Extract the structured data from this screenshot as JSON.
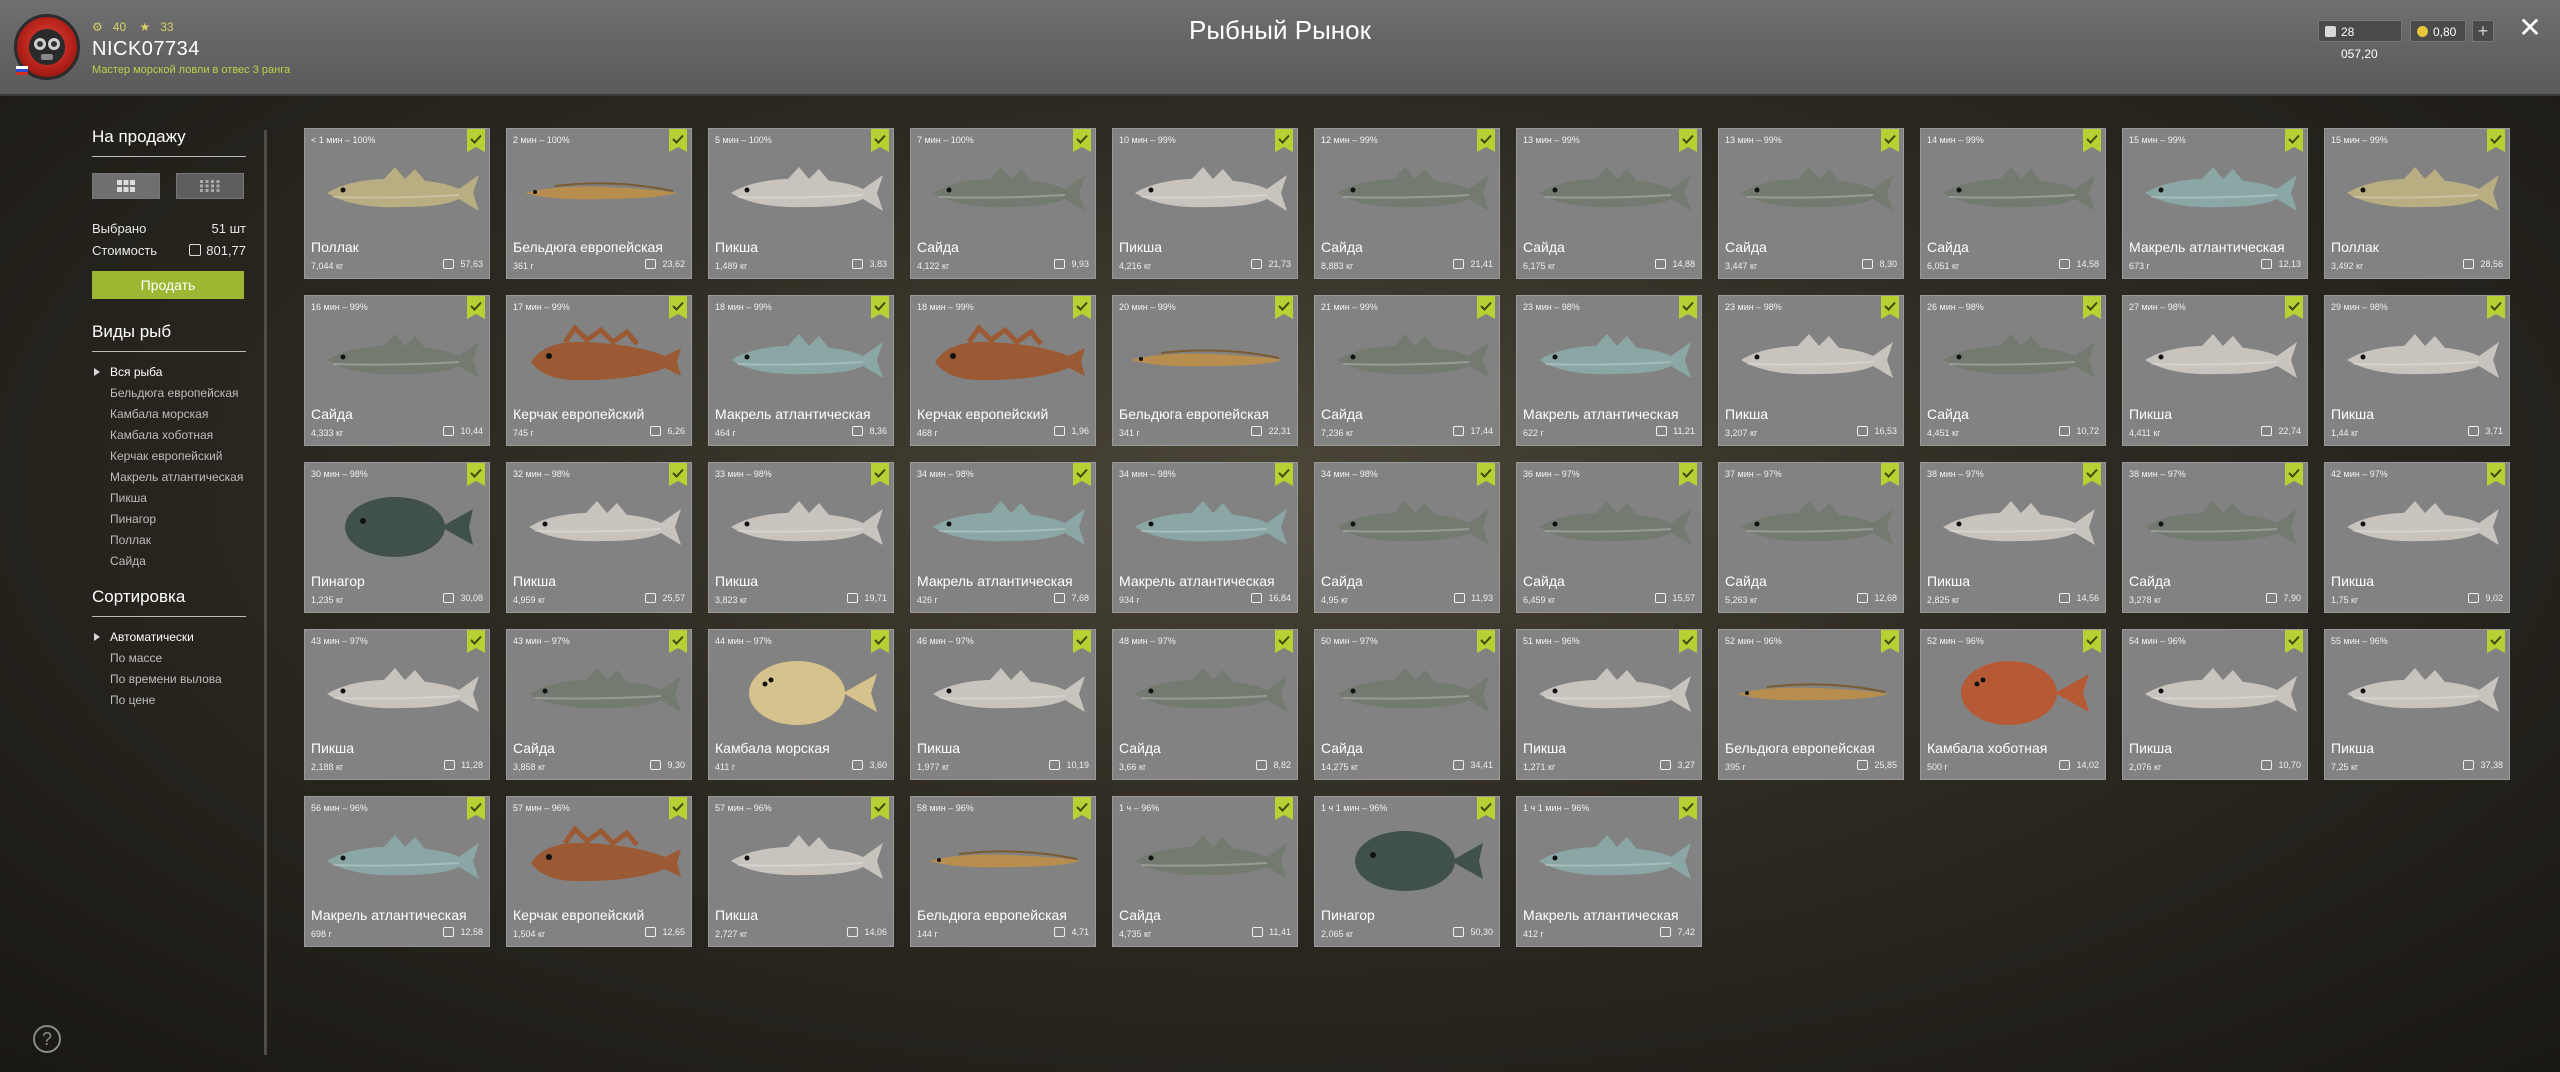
{
  "header": {
    "title": "Рыбный Рынок",
    "player_name": "NICK07734",
    "player_title": "Мастер морской ловли в отвес 3 ранга",
    "level": "40",
    "rank": "33",
    "credits": "28 057,20",
    "gold": "0,80"
  },
  "sidebar": {
    "sale_title": "На продажу",
    "selected_label": "Выбрано",
    "selected_value": "51 шт",
    "cost_label": "Стоимость",
    "cost_value": "801,77",
    "sell_button": "Продать",
    "species_title": "Виды рыб",
    "species": [
      "Вся рыба",
      "Бельдюга европейская",
      "Камбала морская",
      "Камбала хоботная",
      "Керчак европейский",
      "Макрель атлантическая",
      "Пикша",
      "Пинагор",
      "Поллак",
      "Сайда"
    ],
    "sort_title": "Сортировка",
    "sort": [
      "Автоматически",
      "По массе",
      "По времени вылова",
      "По цене"
    ]
  },
  "fish_colors": {
    "Поллак": "#b9ad82",
    "Бельдюга европейская": "#b88e4e",
    "Пикша": "#c9c3bd",
    "Сайда": "#737a70",
    "Макрель атлантическая": "#8aa7a5",
    "Керчак европейский": "#9b5a34",
    "Пинагор": "#3f514a",
    "Камбала морская": "#d6c28d",
    "Камбала хоботная": "#b65a35"
  },
  "cards": [
    {
      "time": "< 1 мин – 100%",
      "name": "Поллак",
      "weight": "7,044 кг",
      "price": "57,63"
    },
    {
      "time": "2 мин – 100%",
      "name": "Бельдюга европейская",
      "weight": "361 г",
      "price": "23,62"
    },
    {
      "time": "5 мин – 100%",
      "name": "Пикша",
      "weight": "1,489 кг",
      "price": "3,83"
    },
    {
      "time": "7 мин – 100%",
      "name": "Сайда",
      "weight": "4,122 кг",
      "price": "9,93"
    },
    {
      "time": "10 мин – 99%",
      "name": "Пикша",
      "weight": "4,216 кг",
      "price": "21,73"
    },
    {
      "time": "12 мин – 99%",
      "name": "Сайда",
      "weight": "8,883 кг",
      "price": "21,41"
    },
    {
      "time": "13 мин – 99%",
      "name": "Сайда",
      "weight": "6,175 кг",
      "price": "14,88"
    },
    {
      "time": "13 мин – 99%",
      "name": "Сайда",
      "weight": "3,447 кг",
      "price": "8,30"
    },
    {
      "time": "14 мин – 99%",
      "name": "Сайда",
      "weight": "6,051 кг",
      "price": "14,58"
    },
    {
      "time": "15 мин – 99%",
      "name": "Макрель атлантическая",
      "weight": "673 г",
      "price": "12,13"
    },
    {
      "time": "15 мин – 99%",
      "name": "Поллак",
      "weight": "3,492 кг",
      "price": "28,56"
    },
    {
      "time": "16 мин – 99%",
      "name": "Сайда",
      "weight": "4,333 кг",
      "price": "10,44"
    },
    {
      "time": "17 мин – 99%",
      "name": "Керчак европейский",
      "weight": "745 г",
      "price": "6,26"
    },
    {
      "time": "18 мин – 99%",
      "name": "Макрель атлантическая",
      "weight": "464 г",
      "price": "8,36"
    },
    {
      "time": "18 мин – 99%",
      "name": "Керчак европейский",
      "weight": "468 г",
      "price": "1,96"
    },
    {
      "time": "20 мин – 99%",
      "name": "Бельдюга европейская",
      "weight": "341 г",
      "price": "22,31"
    },
    {
      "time": "21 мин – 99%",
      "name": "Сайда",
      "weight": "7,236 кг",
      "price": "17,44"
    },
    {
      "time": "23 мин – 98%",
      "name": "Макрель атлантическая",
      "weight": "622 г",
      "price": "11,21"
    },
    {
      "time": "23 мин – 98%",
      "name": "Пикша",
      "weight": "3,207 кг",
      "price": "16,53"
    },
    {
      "time": "26 мин – 98%",
      "name": "Сайда",
      "weight": "4,451 кг",
      "price": "10,72"
    },
    {
      "time": "27 мин – 98%",
      "name": "Пикша",
      "weight": "4,411 кг",
      "price": "22,74"
    },
    {
      "time": "29 мин – 98%",
      "name": "Пикша",
      "weight": "1,44 кг",
      "price": "3,71"
    },
    {
      "time": "30 мин – 98%",
      "name": "Пинагор",
      "weight": "1,235 кг",
      "price": "30,08"
    },
    {
      "time": "32 мин – 98%",
      "name": "Пикша",
      "weight": "4,959 кг",
      "price": "25,57"
    },
    {
      "time": "33 мин – 98%",
      "name": "Пикша",
      "weight": "3,823 кг",
      "price": "19,71"
    },
    {
      "time": "34 мин – 98%",
      "name": "Макрель атлантическая",
      "weight": "426 г",
      "price": "7,68"
    },
    {
      "time": "34 мин – 98%",
      "name": "Макрель атлантическая",
      "weight": "934 г",
      "price": "16,84"
    },
    {
      "time": "34 мин – 98%",
      "name": "Сайда",
      "weight": "4,95 кг",
      "price": "11,93"
    },
    {
      "time": "36 мин – 97%",
      "name": "Сайда",
      "weight": "6,459 кг",
      "price": "15,57"
    },
    {
      "time": "37 мин – 97%",
      "name": "Сайда",
      "weight": "5,263 кг",
      "price": "12,68"
    },
    {
      "time": "38 мин – 97%",
      "name": "Пикша",
      "weight": "2,825 кг",
      "price": "14,56"
    },
    {
      "time": "38 мин – 97%",
      "name": "Сайда",
      "weight": "3,278 кг",
      "price": "7,90"
    },
    {
      "time": "42 мин – 97%",
      "name": "Пикша",
      "weight": "1,75 кг",
      "price": "9,02"
    },
    {
      "time": "43 мин – 97%",
      "name": "Пикша",
      "weight": "2,188 кг",
      "price": "11,28"
    },
    {
      "time": "43 мин – 97%",
      "name": "Сайда",
      "weight": "3,858 кг",
      "price": "9,30"
    },
    {
      "time": "44 мин – 97%",
      "name": "Камбала морская",
      "weight": "411 г",
      "price": "3,60"
    },
    {
      "time": "46 мин – 97%",
      "name": "Пикша",
      "weight": "1,977 кг",
      "price": "10,19"
    },
    {
      "time": "48 мин – 97%",
      "name": "Сайда",
      "weight": "3,66 кг",
      "price": "8,82"
    },
    {
      "time": "50 мин – 97%",
      "name": "Сайда",
      "weight": "14,275 кг",
      "price": "34,41"
    },
    {
      "time": "51 мин – 96%",
      "name": "Пикша",
      "weight": "1,271 кг",
      "price": "3,27"
    },
    {
      "time": "52 мин – 96%",
      "name": "Бельдюга европейская",
      "weight": "395 г",
      "price": "25,85"
    },
    {
      "time": "52 мин – 96%",
      "name": "Камбала хоботная",
      "weight": "500 г",
      "price": "14,02"
    },
    {
      "time": "54 мин – 96%",
      "name": "Пикша",
      "weight": "2,076 кг",
      "price": "10,70"
    },
    {
      "time": "55 мин – 96%",
      "name": "Пикша",
      "weight": "7,25 кг",
      "price": "37,38"
    },
    {
      "time": "56 мин – 96%",
      "name": "Макрель атлантическая",
      "weight": "698 г",
      "price": "12,58"
    },
    {
      "time": "57 мин – 96%",
      "name": "Керчак европейский",
      "weight": "1,504 кг",
      "price": "12,65"
    },
    {
      "time": "57 мин – 96%",
      "name": "Пикша",
      "weight": "2,727 кг",
      "price": "14,06"
    },
    {
      "time": "58 мин – 96%",
      "name": "Бельдюга европейская",
      "weight": "144 г",
      "price": "4,71"
    },
    {
      "time": "1 ч – 96%",
      "name": "Сайда",
      "weight": "4,735 кг",
      "price": "11,41"
    },
    {
      "time": "1 ч 1 мин – 96%",
      "name": "Пинагор",
      "weight": "2,065 кг",
      "price": "50,30"
    },
    {
      "time": "1 ч 1 мин – 96%",
      "name": "Макрель атлантическая",
      "weight": "412 г",
      "price": "7,42"
    }
  ]
}
